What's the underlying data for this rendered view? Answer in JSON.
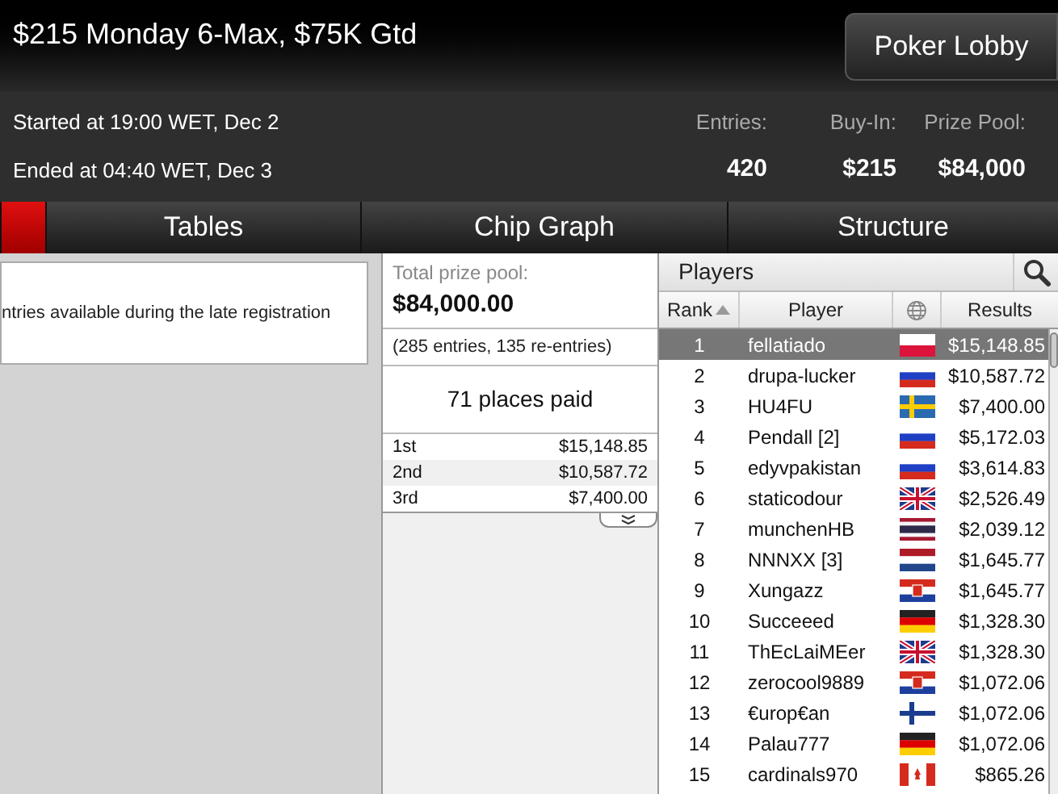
{
  "header": {
    "title": "$215 Monday 6-Max, $75K Gtd",
    "lobby_button": "Poker Lobby"
  },
  "info": {
    "started": "Started at 19:00 WET, Dec 2",
    "ended": "Ended at 04:40 WET, Dec 3",
    "stats": [
      {
        "label": "Entries:",
        "value": "420"
      },
      {
        "label": "Buy-In:",
        "value": "$215"
      },
      {
        "label": "Prize Pool:",
        "value": "$84,000"
      }
    ]
  },
  "tabs": [
    {
      "selected": true
    },
    {
      "label": "Tables",
      "selected": false
    },
    {
      "label": "Chip Graph",
      "selected": false
    },
    {
      "label": "Structure",
      "selected": false
    }
  ],
  "notice": "ntries available during the late registration",
  "prize": {
    "label": "Total prize pool:",
    "total": "$84,000.00",
    "breakdown": "(285 entries, 135 re-entries)",
    "places": "71 places paid",
    "payouts": [
      {
        "place": "1st",
        "amount": "$15,148.85"
      },
      {
        "place": "2nd",
        "amount": "$10,587.72"
      },
      {
        "place": "3rd",
        "amount": "$7,400.00"
      }
    ]
  },
  "players": {
    "title": "Players",
    "columns": [
      "Rank",
      "Player",
      "Results"
    ],
    "rows": [
      {
        "rank": "1",
        "name": "fellatiado",
        "kind": "pl",
        "result": "$15,148.85",
        "selected": true
      },
      {
        "rank": "2",
        "name": "drupa-lucker",
        "kind": "ru",
        "result": "$10,587.72",
        "selected": false
      },
      {
        "rank": "3",
        "name": "HU4FU",
        "kind": "se",
        "result": "$7,400.00",
        "selected": false
      },
      {
        "rank": "4",
        "name": "Pendall [2]",
        "kind": "ru",
        "result": "$5,172.03",
        "selected": false
      },
      {
        "rank": "5",
        "name": "edyvpakistan",
        "kind": "ru",
        "result": "$3,614.83",
        "selected": false
      },
      {
        "rank": "6",
        "name": "staticodour",
        "kind": "gb",
        "result": "$2,526.49",
        "selected": false
      },
      {
        "rank": "7",
        "name": "munchenHB",
        "kind": "th",
        "result": "$2,039.12",
        "selected": false
      },
      {
        "rank": "8",
        "name": "NNNXX [3]",
        "kind": "nl",
        "result": "$1,645.77",
        "selected": false
      },
      {
        "rank": "9",
        "name": "Xungazz",
        "kind": "hr",
        "result": "$1,645.77",
        "selected": false
      },
      {
        "rank": "10",
        "name": "Succeeed",
        "kind": "de",
        "result": "$1,328.30",
        "selected": false
      },
      {
        "rank": "11",
        "name": "ThEcLaiMEer",
        "kind": "gb",
        "result": "$1,328.30",
        "selected": false
      },
      {
        "rank": "12",
        "name": "zerocool9889",
        "kind": "hr",
        "result": "$1,072.06",
        "selected": false
      },
      {
        "rank": "13",
        "name": "€urop€an",
        "kind": "fi",
        "result": "$1,072.06",
        "selected": false
      },
      {
        "rank": "14",
        "name": "Palau777",
        "kind": "de",
        "result": "$1,072.06",
        "selected": false
      },
      {
        "rank": "15",
        "name": "cardinals970",
        "kind": "ca",
        "result": "$865.26",
        "selected": false
      }
    ]
  }
}
